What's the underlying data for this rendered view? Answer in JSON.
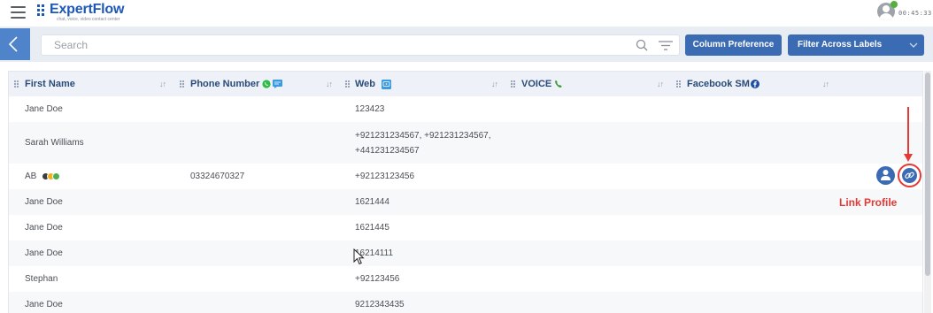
{
  "header": {
    "logo_text": "ExpertFlow",
    "logo_tagline": "chat, voice, video contact center",
    "timer": "00:45:33"
  },
  "toolbar": {
    "search_placeholder": "Search",
    "column_preference_label": "Column Preference",
    "filter_labels_label": "Filter Across Labels"
  },
  "table": {
    "columns": [
      {
        "label": "First Name"
      },
      {
        "label": "Phone Number",
        "icons": [
          "whatsapp-icon",
          "sms-icon"
        ]
      },
      {
        "label": "Web",
        "icons": [
          "web-chat-icon"
        ]
      },
      {
        "label": "VOICE",
        "icons": [
          "phone-icon"
        ]
      },
      {
        "label": "Facebook SM",
        "icons": [
          "facebook-icon"
        ]
      }
    ],
    "rows": [
      {
        "first_name": "Jane Doe",
        "phone": "",
        "web": "123423"
      },
      {
        "first_name": "Sarah Williams",
        "phone": "",
        "web_line1": "+921231234567, +921231234567,",
        "web_line2": "+441231234567"
      },
      {
        "first_name": "AB",
        "phone": "03324670327",
        "web": "+92123123456",
        "label_colors": [
          "#3d3d3d",
          "#f2b01e",
          "#4caf50"
        ]
      },
      {
        "first_name": "Jane Doe",
        "phone": "",
        "web": "1621444"
      },
      {
        "first_name": "Jane Doe",
        "phone": "",
        "web": "1621445"
      },
      {
        "first_name": "Jane Doe",
        "phone": "",
        "web": "16214111"
      },
      {
        "first_name": "Stephan",
        "phone": "",
        "web": "+92123456"
      },
      {
        "first_name": "Jane Doe",
        "phone": "",
        "web": "9212343435"
      }
    ]
  },
  "annotation": {
    "label": "Link Profile",
    "color": "#e53935"
  },
  "colors": {
    "primary": "#3b6bb2",
    "back_button": "#4f84ca",
    "header_text": "#2a4a78",
    "presence": "#55b03e"
  }
}
